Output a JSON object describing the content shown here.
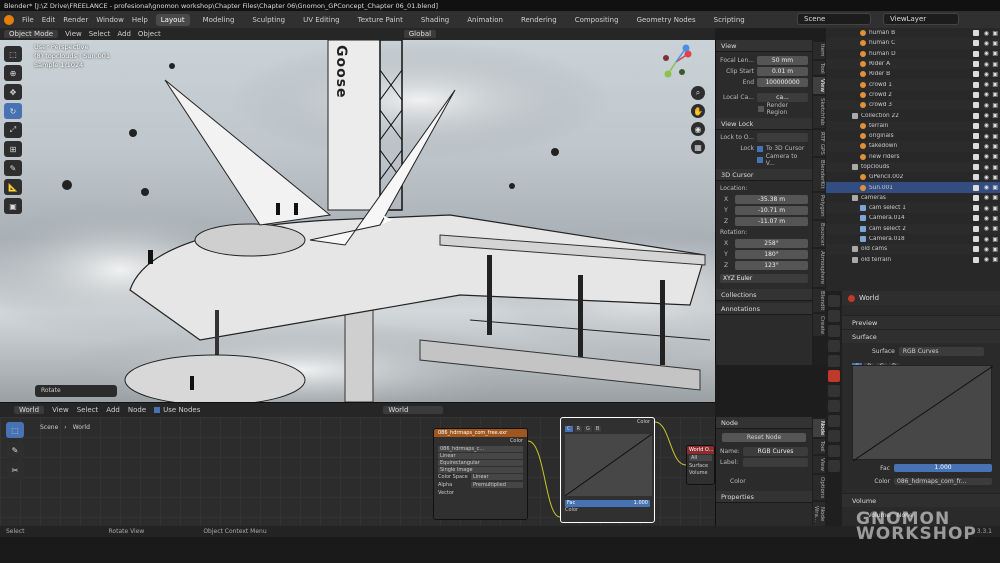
{
  "window": {
    "title": "Blender* [J:\\Z Drive\\FREELANCE - profesional\\gnomon workshop\\Chapter Files\\Chapter 06\\Gnomon_GPConcept_Chapter 06_01.blend]"
  },
  "menu": {
    "items": [
      "File",
      "Edit",
      "Render",
      "Window",
      "Help"
    ],
    "workspaces": [
      "Layout",
      "Modeling",
      "Sculpting",
      "UV Editing",
      "Texture Paint",
      "Shading",
      "Animation",
      "Rendering",
      "Compositing",
      "Geometry Nodes",
      "Scripting"
    ],
    "active_workspace": "Layout",
    "scene": "Scene",
    "view_layer": "ViewLayer"
  },
  "viewport": {
    "mode": "Object Mode",
    "menus": [
      "View",
      "Select",
      "Add",
      "Object"
    ],
    "transform": "Global",
    "info_lines": [
      "User Perspective",
      "(8) topclouds | Sun.001",
      "Sample 1/1024"
    ],
    "sign_text": "Goose",
    "last_op": "Rotate"
  },
  "npanel": {
    "view_title": "View",
    "focal_label": "Focal Len...",
    "focal_value": "50 mm",
    "clip_label": "Clip Start",
    "clip_value": "0.01 m",
    "end_label": "End",
    "end_value": "100000000",
    "local_label": "Local Ca...",
    "local_value": "ca...",
    "render_region": "Render Region",
    "view_lock_title": "View Lock",
    "lock_to_label": "Lock to O...",
    "lock_label": "Lock",
    "lock_opt1": "To 3D Cursor",
    "lock_opt2": "Camera to V...",
    "cursor_title": "3D Cursor",
    "location_label": "Location:",
    "x_label": "X",
    "x_value": "-35.38 m",
    "y_label": "Y",
    "y_value": "-10.71 m",
    "z_label": "Z",
    "z_value": "-11.07 m",
    "rotation_label": "Rotation:",
    "rx_value": "258°",
    "ry_value": "180°",
    "rz_value": "123°",
    "rot_mode": "XYZ Euler",
    "collections": "Collections",
    "annotations": "Annotations",
    "tabs": [
      "Item",
      "Tool",
      "View",
      "Sketchfab",
      "RTF GPS",
      "BlenderKit",
      "Polygon",
      "Bouncer",
      "Atmosphere",
      "Blendit",
      "Create"
    ]
  },
  "outliner": {
    "rows": [
      {
        "name": "human B",
        "type": "obj"
      },
      {
        "name": "human C",
        "type": "obj"
      },
      {
        "name": "human D",
        "type": "obj"
      },
      {
        "name": "Rider A",
        "type": "obj"
      },
      {
        "name": "Rider B",
        "type": "obj"
      },
      {
        "name": "crowd 1",
        "type": "obj"
      },
      {
        "name": "crowd 2",
        "type": "obj"
      },
      {
        "name": "crowd 3",
        "type": "obj"
      },
      {
        "name": "Collection 22",
        "type": "coll"
      },
      {
        "name": "terrain",
        "type": "obj"
      },
      {
        "name": "originals",
        "type": "obj"
      },
      {
        "name": "takedown",
        "type": "obj"
      },
      {
        "name": "new riders",
        "type": "obj"
      },
      {
        "name": "topclouds",
        "type": "coll"
      },
      {
        "name": "GPencil.002",
        "type": "obj"
      },
      {
        "name": "Sun.001",
        "type": "sel"
      },
      {
        "name": "cameras",
        "type": "coll"
      },
      {
        "name": "cam select 1",
        "type": "cam"
      },
      {
        "name": "Camera.014",
        "type": "cam"
      },
      {
        "name": "cam select 2",
        "type": "cam"
      },
      {
        "name": "Camera.018",
        "type": "cam"
      },
      {
        "name": "old cams",
        "type": "coll"
      },
      {
        "name": "old terrain",
        "type": "coll"
      }
    ]
  },
  "properties": {
    "world": "World",
    "preview": "Preview",
    "surface_title": "Surface",
    "surface_label": "Surface",
    "surface_value": "RGB Curves",
    "channels": [
      "C",
      "R",
      "G",
      "B"
    ],
    "fac_label": "Fac",
    "fac_value": "1.000",
    "color_label": "Color",
    "color_value": "086_hdrmaps_com_fr...",
    "volume_title": "Volume",
    "volume_label": "Volume",
    "volume_value": "None"
  },
  "node_editor": {
    "type": "World",
    "menus": [
      "View",
      "Select",
      "Add",
      "Node"
    ],
    "use_nodes": "Use Nodes",
    "world_name": "World",
    "breadcrumb": [
      "Scene",
      "World"
    ],
    "image_node": {
      "title": "086_hdrmaps_com_free.exr",
      "output": "Color",
      "file": "086_hdrmaps_c...",
      "interp": "Linear",
      "proj": "Equirectangular",
      "source": "Single Image",
      "space_label": "Color Space",
      "space_value": "Linear",
      "alpha_label": "Alpha",
      "alpha_value": "Premultiplied",
      "input": "Vector"
    },
    "curves_node": {
      "output": "Color",
      "channels": [
        "C",
        "R",
        "G",
        "B"
      ],
      "fac_label": "Fac",
      "fac_value": "1.000",
      "input": "Color"
    },
    "world_node": {
      "title": "World O...",
      "all": "All",
      "surface": "Surface",
      "volume": "Volume"
    }
  },
  "node_panel": {
    "title": "Node",
    "reset": "Reset Node",
    "name_label": "Name:",
    "name_value": "RGB Curves",
    "label_label": "Label:",
    "color_section": "Color",
    "properties": "Properties",
    "tabs": [
      "Node",
      "Tool",
      "View",
      "Options",
      "Node Wra..."
    ]
  },
  "status": {
    "items": [
      "Select",
      "Rotate View",
      "Object Context Menu"
    ],
    "version": "3.3.1"
  },
  "branding": {
    "line1": "GNOMON",
    "line2": "WORKSHOP"
  }
}
